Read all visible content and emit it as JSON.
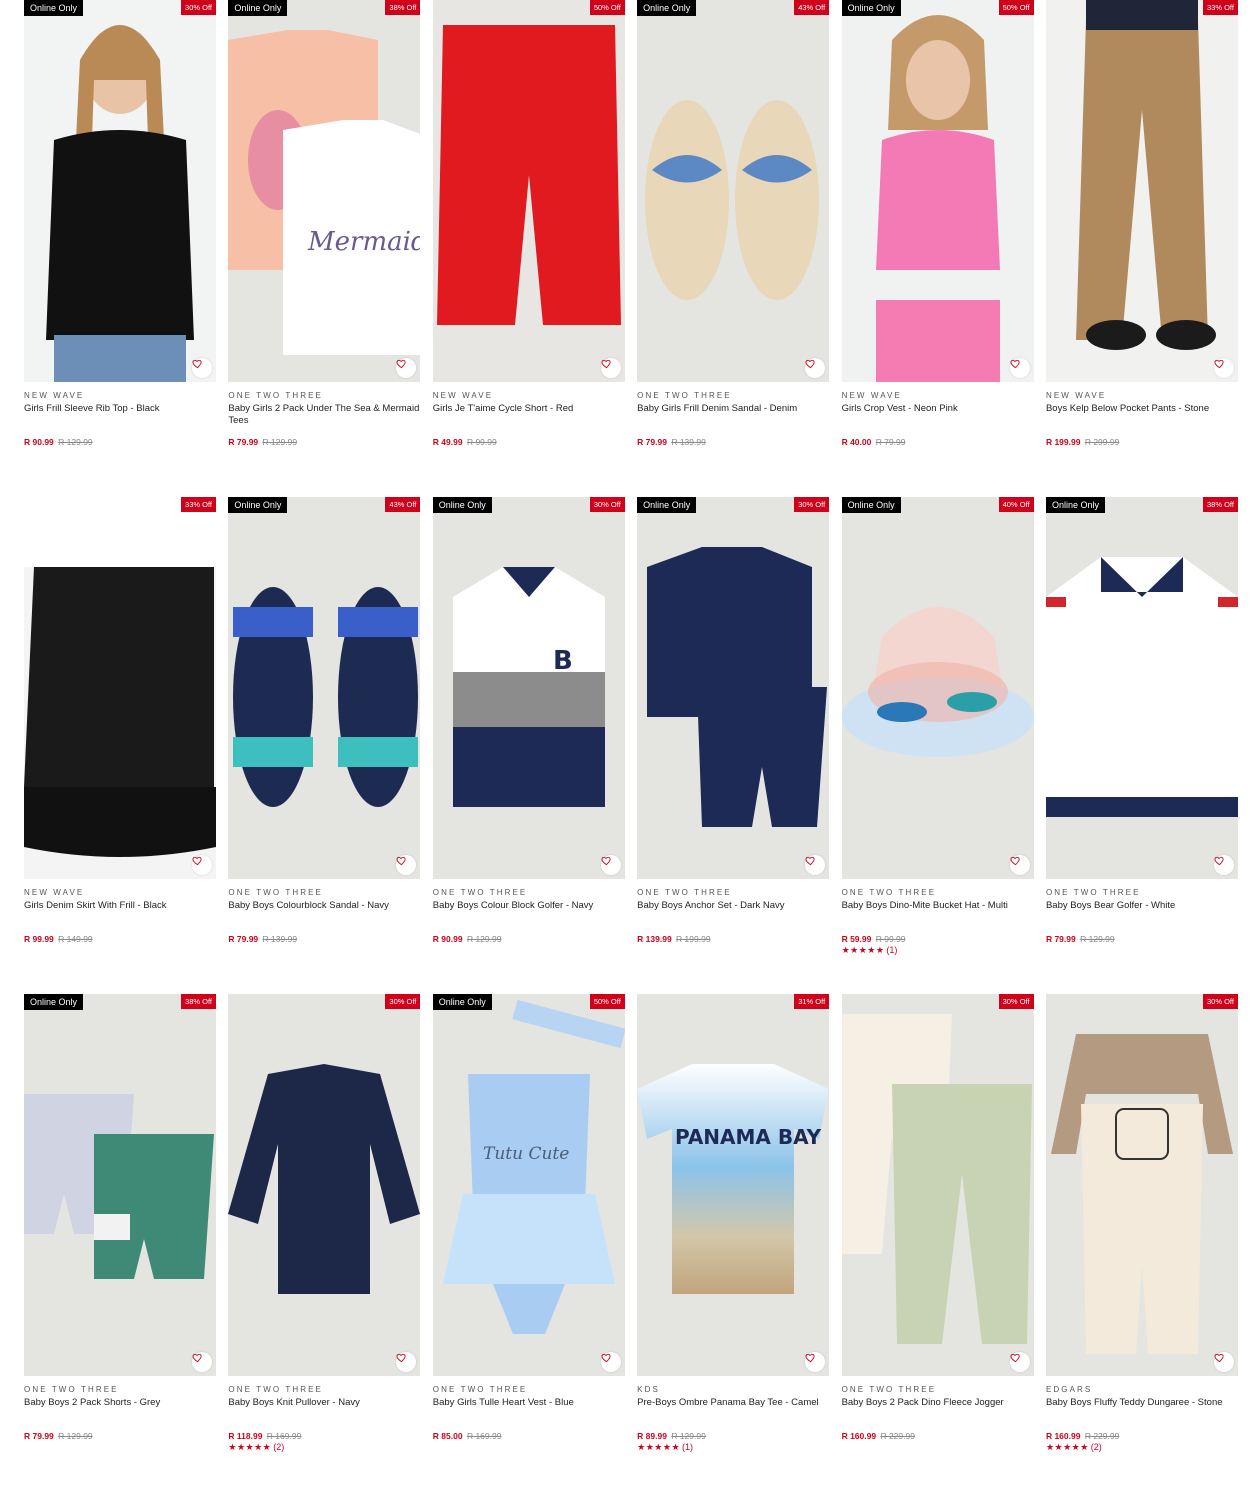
{
  "wishlist_icon": "heart-outline-icon",
  "colors": {
    "sale": "#d0021b",
    "badge_online": "#000000",
    "image_bg": "#e4e4e1"
  },
  "products": [
    {
      "brand": "NEW WAVE",
      "name": "Girls Frill Sleeve Rib Top - Black",
      "price": "R 90.99",
      "was": "R 129.99",
      "badge_online": "Online Only",
      "badge_discount": "30% Off",
      "rating": null,
      "reviews": null
    },
    {
      "brand": "ONE TWO THREE",
      "name": "Baby Girls 2 Pack Under The Sea & Mermaid Tees",
      "price": "R 79.99",
      "was": "R 129.99",
      "badge_online": "Online Only",
      "badge_discount": "38% Off",
      "rating": null,
      "reviews": null
    },
    {
      "brand": "NEW WAVE",
      "name": "Girls Je T'aime Cycle Short - Red",
      "price": "R 49.99",
      "was": "R 99.99",
      "badge_online": null,
      "badge_discount": "50% Off",
      "rating": null,
      "reviews": null
    },
    {
      "brand": "ONE TWO THREE",
      "name": "Baby Girls Frill Denim Sandal - Denim",
      "price": "R 79.99",
      "was": "R 139.99",
      "badge_online": "Online Only",
      "badge_discount": "43% Off",
      "rating": null,
      "reviews": null
    },
    {
      "brand": "NEW WAVE",
      "name": "Girls Crop Vest - Neon Pink",
      "price": "R 40.00",
      "was": "R 79.99",
      "badge_online": "Online Only",
      "badge_discount": "50% Off",
      "rating": null,
      "reviews": null
    },
    {
      "brand": "NEW WAVE",
      "name": "Boys Kelp Below Pocket Pants - Stone",
      "price": "R 199.99",
      "was": "R 299.99",
      "badge_online": null,
      "badge_discount": "33% Off",
      "rating": null,
      "reviews": null
    },
    {
      "brand": "NEW WAVE",
      "name": "Girls Denim Skirt With Frill - Black",
      "price": "R 99.99",
      "was": "R 149.99",
      "badge_online": null,
      "badge_discount": "33% Off",
      "rating": null,
      "reviews": null
    },
    {
      "brand": "ONE TWO THREE",
      "name": "Baby Boys Colourblock Sandal - Navy",
      "price": "R 79.99",
      "was": "R 139.99",
      "badge_online": "Online Only",
      "badge_discount": "43% Off",
      "rating": null,
      "reviews": null
    },
    {
      "brand": "ONE TWO THREE",
      "name": "Baby Boys Colour Block Golfer - Navy",
      "price": "R 90.99",
      "was": "R 129.99",
      "badge_online": "Online Only",
      "badge_discount": "30% Off",
      "rating": null,
      "reviews": null
    },
    {
      "brand": "ONE TWO THREE",
      "name": "Baby Boys Anchor Set - Dark Navy",
      "price": "R 139.99",
      "was": "R 199.99",
      "badge_online": "Online Only",
      "badge_discount": "30% Off",
      "rating": null,
      "reviews": null
    },
    {
      "brand": "ONE TWO THREE",
      "name": "Baby Boys Dino-Mite Bucket Hat - Multi",
      "price": "R 59.99",
      "was": "R 99.99",
      "badge_online": "Online Only",
      "badge_discount": "40% Off",
      "rating": 5,
      "reviews": "(1)"
    },
    {
      "brand": "ONE TWO THREE",
      "name": "Baby Boys Bear Golfer - White",
      "price": "R 79.99",
      "was": "R 129.99",
      "badge_online": "Online Only",
      "badge_discount": "38% Off",
      "rating": null,
      "reviews": null
    },
    {
      "brand": "ONE TWO THREE",
      "name": "Baby Boys 2 Pack Shorts - Grey",
      "price": "R 79.99",
      "was": "R 129.99",
      "badge_online": "Online Only",
      "badge_discount": "38% Off",
      "rating": null,
      "reviews": null
    },
    {
      "brand": "ONE TWO THREE",
      "name": "Baby Boys Knit Pullover - Navy",
      "price": "R 118.99",
      "was": "R 169.99",
      "badge_online": null,
      "badge_discount": "30% Off",
      "rating": 5,
      "reviews": "(2)"
    },
    {
      "brand": "ONE TWO THREE",
      "name": "Baby Girls Tulle Heart Vest - Blue",
      "price": "R 85.00",
      "was": "R 169.99",
      "badge_online": "Online Only",
      "badge_discount": "50% Off",
      "rating": null,
      "reviews": null
    },
    {
      "brand": "KDS",
      "name": "Pre-Boys Ombre Panama Bay Tee - Camel",
      "price": "R 89.99",
      "was": "R 129.99",
      "badge_online": null,
      "badge_discount": "31% Off",
      "rating": 5,
      "reviews": "(1)"
    },
    {
      "brand": "ONE TWO THREE",
      "name": "Baby Boys 2 Pack Dino Fleece Jogger",
      "price": "R 160.99",
      "was": "R 229.99",
      "badge_online": null,
      "badge_discount": "30% Off",
      "rating": null,
      "reviews": null
    },
    {
      "brand": "EDGARS",
      "name": "Baby Boys Fluffy Teddy Dungaree - Stone",
      "price": "R 160.99",
      "was": "R 229.99",
      "badge_online": null,
      "badge_discount": "30% Off",
      "rating": 4.5,
      "reviews": "(2)"
    }
  ]
}
